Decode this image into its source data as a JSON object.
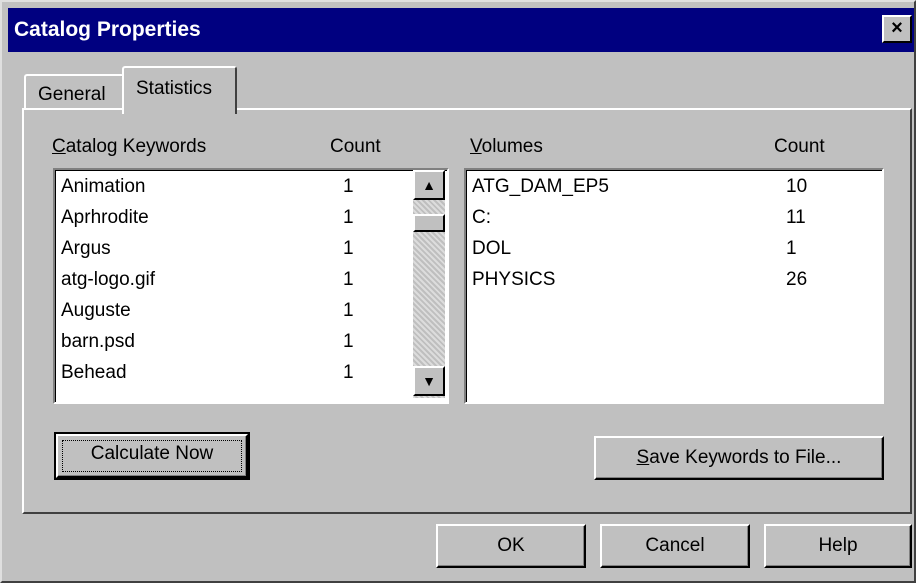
{
  "window": {
    "title": "Catalog Properties",
    "close_glyph": "×"
  },
  "tabs": [
    {
      "label": "General"
    },
    {
      "label": "Statistics"
    }
  ],
  "keywords": {
    "header_underlined": "C",
    "header_rest": "atalog Keywords",
    "count_header": "Count",
    "rows": [
      {
        "keyword": "Animation",
        "count": "1"
      },
      {
        "keyword": "Aprhrodite",
        "count": "1"
      },
      {
        "keyword": "Argus",
        "count": "1"
      },
      {
        "keyword": "atg-logo.gif",
        "count": "1"
      },
      {
        "keyword": "Auguste",
        "count": "1"
      },
      {
        "keyword": "barn.psd",
        "count": "1"
      },
      {
        "keyword": "Behead",
        "count": "1"
      }
    ],
    "scroll_up_icon": "▲",
    "scroll_down_icon": "▼"
  },
  "volumes": {
    "header_underlined": "V",
    "header_rest": "olumes",
    "count_header": "Count",
    "rows": [
      {
        "volume": "ATG_DAM_EP5",
        "count": "10"
      },
      {
        "volume": "C:",
        "count": "11"
      },
      {
        "volume": "DOL",
        "count": "1"
      },
      {
        "volume": "PHYSICS",
        "count": "26"
      }
    ]
  },
  "buttons": {
    "calculate": "Calculate Now",
    "save_underlined": "S",
    "save_rest": "ave Keywords to File...",
    "ok": "OK",
    "cancel": "Cancel",
    "help": "Help"
  }
}
